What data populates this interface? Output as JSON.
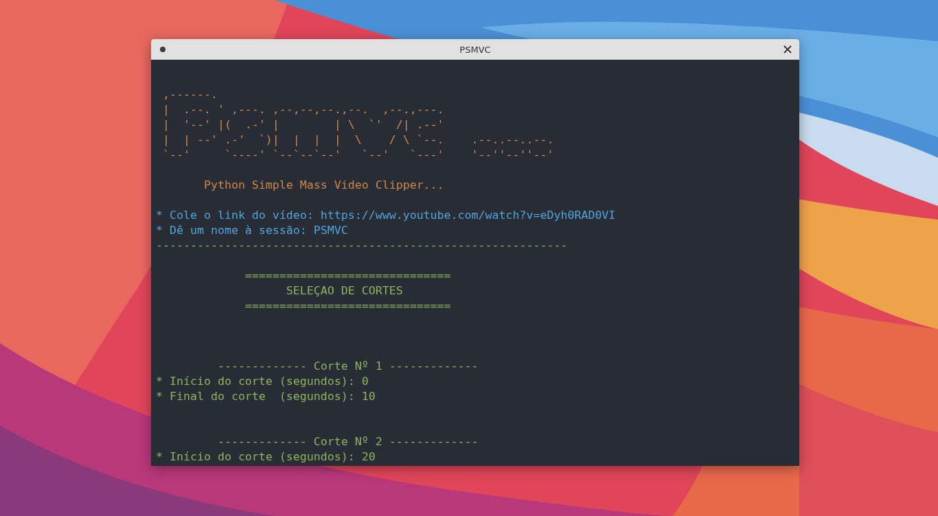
{
  "window": {
    "title": "PSMVC"
  },
  "terminal": {
    "lines": [
      {
        "kind": "blank"
      },
      {
        "kind": "art",
        "text": " ,------.",
        "color": "#d0874c"
      },
      {
        "kind": "art",
        "text": " |  .--. ' ,---. ,--,--,--.,--.  ,--.,---.",
        "color": "#d0874c"
      },
      {
        "kind": "art",
        "text": " |  '--' |(  .-' |        | \\  `'  /| .--'",
        "color": "#d0874c"
      },
      {
        "kind": "art",
        "text": " |  | --' .-'  `)|  |  |  |  \\    / \\ `--.    .--..--..--.",
        "color": "#d0874c"
      },
      {
        "kind": "art",
        "text": " `--'     `----' `--`--`--'   `--'   `---'    '--''--''--'",
        "color": "#d0874c"
      },
      {
        "kind": "blank"
      },
      {
        "kind": "text",
        "text": "       Python Simple Mass Video Clipper...",
        "color": "#d0874c"
      },
      {
        "kind": "blank"
      },
      {
        "kind": "text",
        "text": "* Cole o link do vídeo: https://www.youtube.com/watch?v=eDyh0RAD0VI",
        "color": "#4fa4dc"
      },
      {
        "kind": "text",
        "text": "* Dê um nome à sessão: PSMVC",
        "color": "#4fa4dc"
      },
      {
        "kind": "text",
        "text": "------------------------------------------------------------",
        "color": "#8db35f"
      },
      {
        "kind": "blank"
      },
      {
        "kind": "text",
        "text": "             ==============================",
        "color": "#8db35f"
      },
      {
        "kind": "text",
        "text": "                   SELEÇAO DE CORTES",
        "color": "#8db35f"
      },
      {
        "kind": "text",
        "text": "             ==============================",
        "color": "#8db35f"
      },
      {
        "kind": "blank"
      },
      {
        "kind": "blank"
      },
      {
        "kind": "blank"
      },
      {
        "kind": "text",
        "text": "         ------------- Corte Nº 1 -------------",
        "color": "#8db35f"
      },
      {
        "kind": "text",
        "text": "* Início do corte (segundos): 0",
        "color": "#8db35f"
      },
      {
        "kind": "text",
        "text": "* Final do corte  (segundos): 10",
        "color": "#8db35f"
      },
      {
        "kind": "blank"
      },
      {
        "kind": "blank"
      },
      {
        "kind": "text",
        "text": "         ------------- Corte Nº 2 -------------",
        "color": "#8db35f"
      },
      {
        "kind": "text",
        "text": "* Início do corte (segundos): 20",
        "color": "#8db35f"
      }
    ]
  }
}
